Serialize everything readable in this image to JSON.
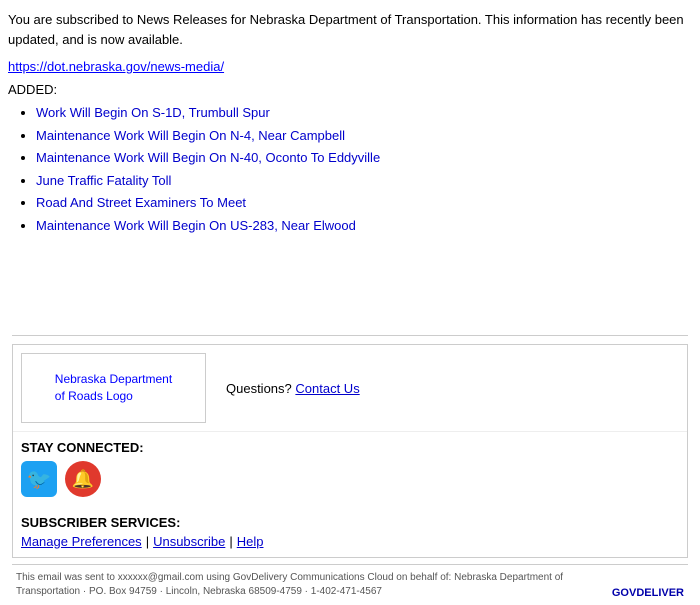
{
  "email": {
    "intro": {
      "text_start": "You are subscribed to News Releases for Nebraska Department of Transportation. This information has recently been updated, and is now available.",
      "link": "https://dot.nebraska.gov/news-media/",
      "link_display": "https://dot.nebraska.gov/news-media/"
    },
    "added_label": "ADDED:",
    "news_items": [
      "Work Will Begin On S-1D, Trumbull Spur",
      "Maintenance Work Will Begin On N-4, Near Campbell",
      "Maintenance Work Will Begin On N-40, Oconto To Eddyville",
      "June Traffic Fatality Toll",
      "Road And Street Examiners To Meet",
      "Maintenance Work Will Begin On US-283, Near Elwood"
    ]
  },
  "footer": {
    "logo_alt": "Nebraska Department of Roads Logo",
    "logo_text_line1": "Nebraska Department",
    "logo_text_line2": "of Roads Logo",
    "questions_label": "Questions?",
    "contact_us_label": "Contact Us",
    "stay_connected_label": "STAY CONNECTED:",
    "subscriber_label": "SUBSCRIBER SERVICES:",
    "manage_preferences_label": "Manage Preferences",
    "unsubscribe_label": "Unsubscribe",
    "help_label": "Help",
    "bottom_text": "This email was sent to xxxxxx@gmail.com using GovDelivery Communications Cloud on behalf of: Nebraska Department of Transportation · PO. Box 94759 · Lincoln, Nebraska 68509-4759 · 1-402-471-4567",
    "govdelivery_label": "GOVDELIVER"
  }
}
